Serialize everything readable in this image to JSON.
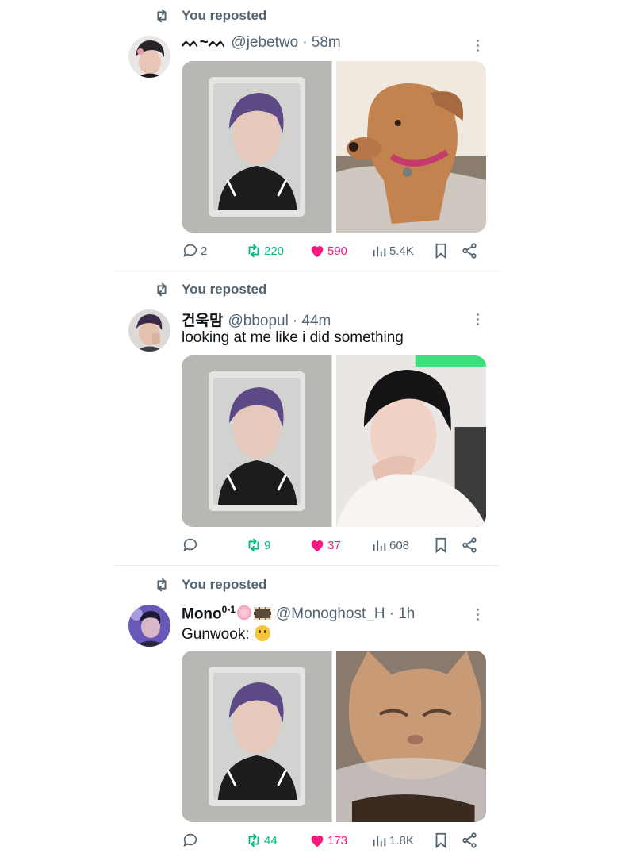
{
  "posts": [
    {
      "repost_label": "You reposted",
      "name": "ᨓ~ᨓ",
      "handle": "@jebetwo",
      "time": "· 58m",
      "text": "",
      "stats": {
        "replies": "2",
        "reposts": "220",
        "likes": "590",
        "views": "5.4K"
      }
    },
    {
      "repost_label": "You reposted",
      "name": "건욱맘",
      "handle": "@bbopul",
      "time": "· 44m",
      "text": "looking at me like i did something",
      "stats": {
        "replies": "",
        "reposts": "9",
        "likes": "37",
        "views": "608"
      }
    },
    {
      "repost_label": "You reposted",
      "name": "Mono",
      "name_sup": "0-1",
      "handle": "@Monoghost_H",
      "time": "· 1h",
      "text": "Gunwook:",
      "stats": {
        "replies": "",
        "reposts": "44",
        "likes": "173",
        "views": "1.8K"
      }
    }
  ],
  "colors": {
    "repost": "#00ba7c",
    "like": "#f91880",
    "muted": "#536471"
  }
}
